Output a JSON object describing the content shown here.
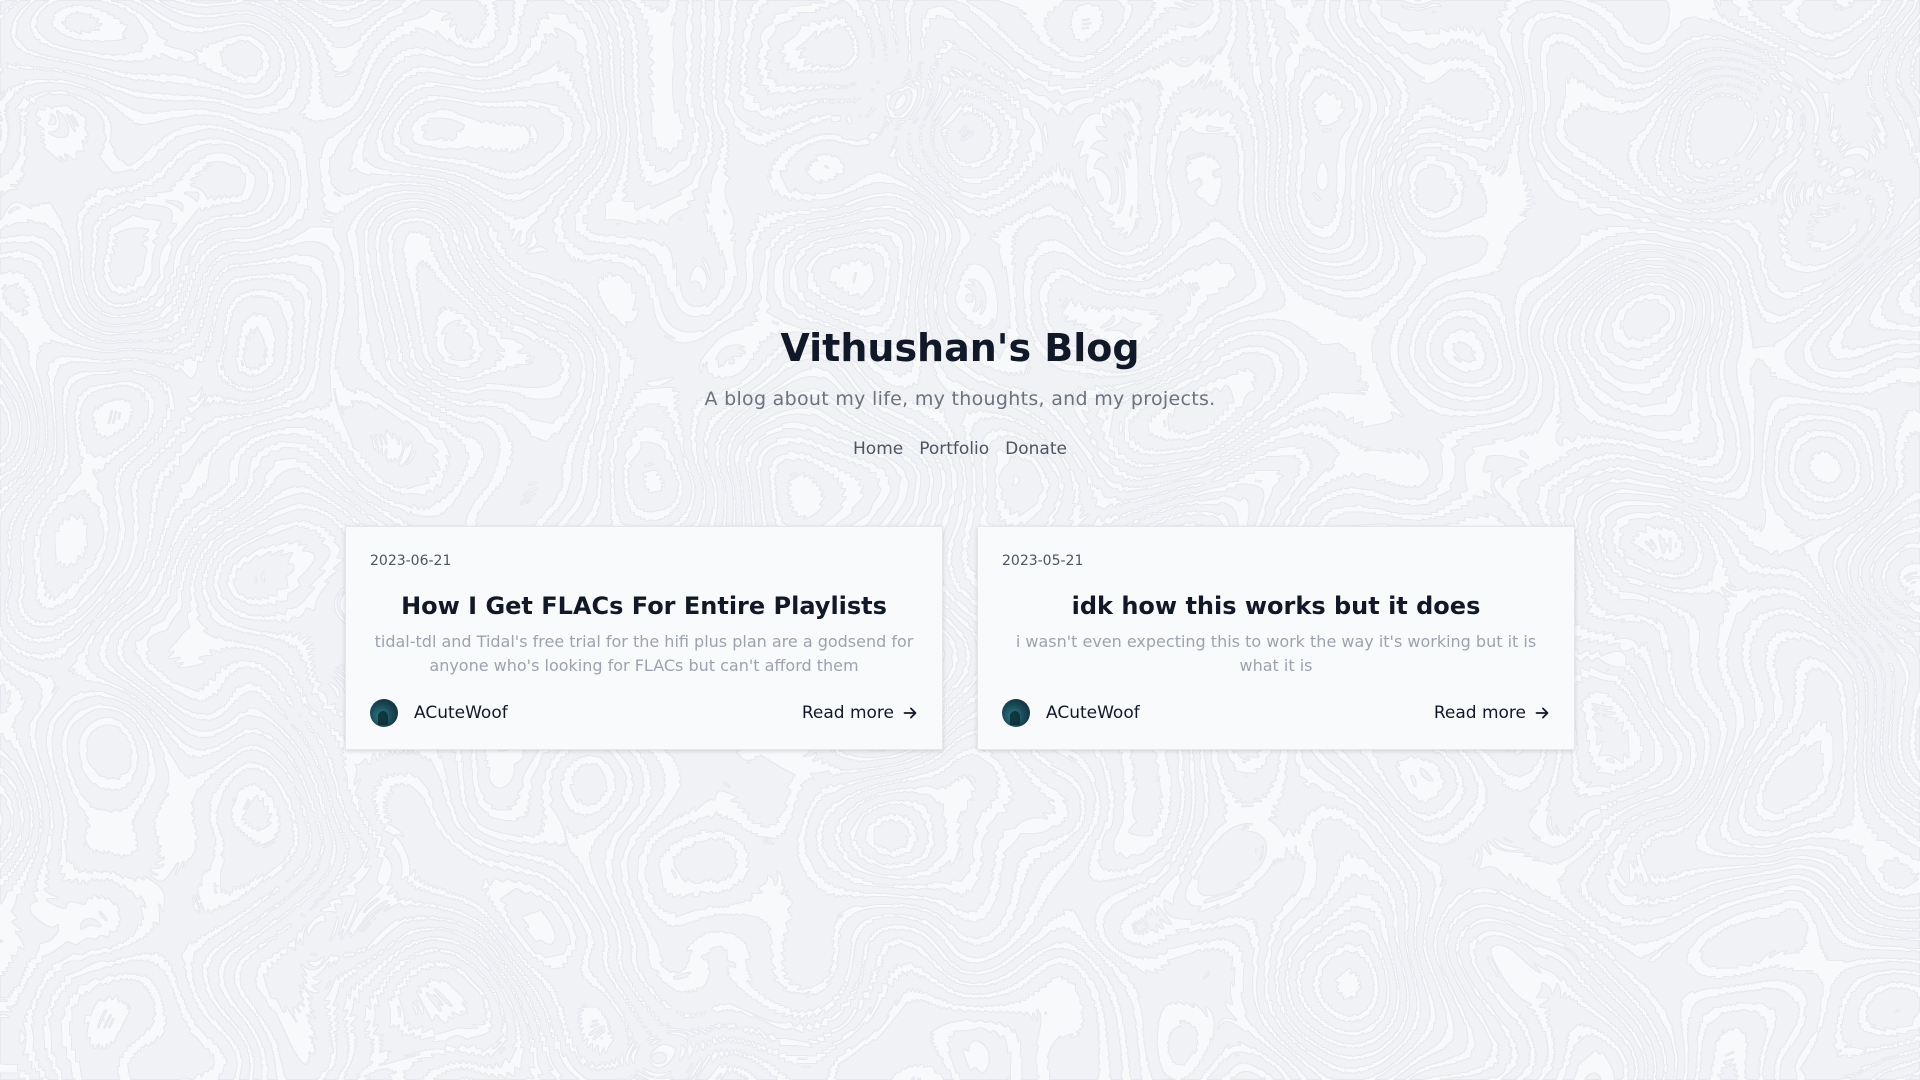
{
  "header": {
    "title": "Vithushan's Blog",
    "subtitle": "A blog about my life, my thoughts, and my projects."
  },
  "nav": {
    "items": [
      {
        "label": "Home"
      },
      {
        "label": "Portfolio"
      },
      {
        "label": "Donate"
      }
    ]
  },
  "posts": [
    {
      "date": "2023-06-21",
      "title": "How I Get FLACs For Entire Playlists",
      "excerpt": "tidal-tdl and Tidal's free trial for the hifi plus plan are a godsend for anyone who's looking for FLACs but can't afford them",
      "author": "ACuteWoof",
      "read_more": "Read more",
      "icon": "arrow-right-icon"
    },
    {
      "date": "2023-05-21",
      "title": "idk how this works but it does",
      "excerpt": "i wasn't even expecting this to work the way it's working but it is what it is",
      "author": "ACuteWoof",
      "read_more": "Read more",
      "icon": "arrow-right-icon"
    }
  ],
  "colors": {
    "background": "#f8f9fb",
    "title": "#111827",
    "subtitle": "#6b7280",
    "nav": "#4b5563",
    "excerpt": "#9ca3af",
    "card_bg": "#f9fafb",
    "card_border": "#e5e7eb",
    "topo_lines": "#d9dde4"
  }
}
